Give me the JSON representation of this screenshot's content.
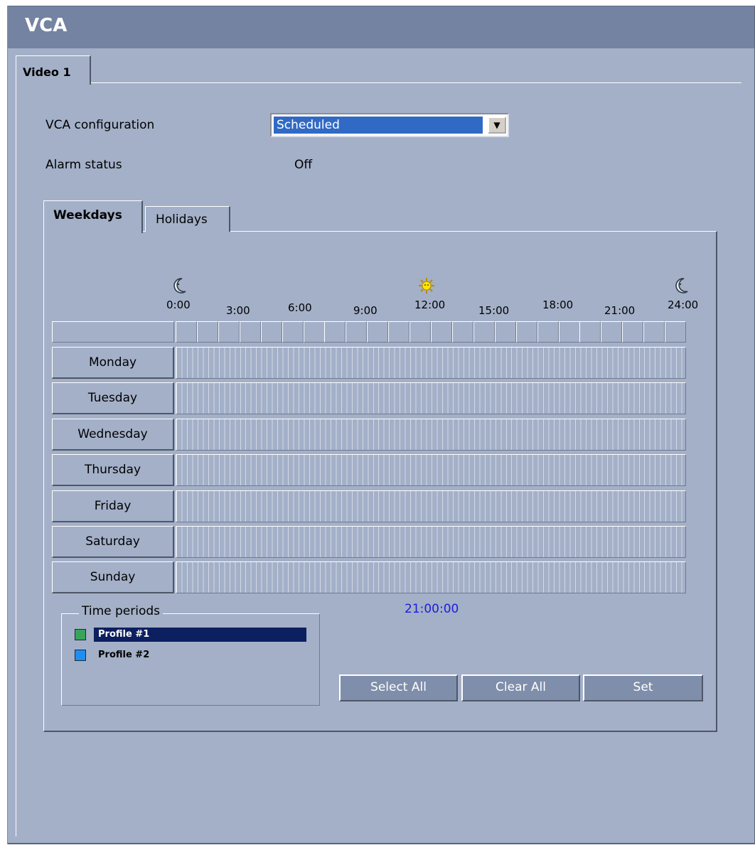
{
  "header": {
    "title": "VCA"
  },
  "tabs": {
    "video": "Video 1"
  },
  "config": {
    "vca_label": "VCA configuration",
    "vca_value": "Scheduled",
    "alarm_label": "Alarm status",
    "alarm_value": "Off"
  },
  "schedule_tabs": {
    "weekdays": "Weekdays",
    "holidays": "Holidays"
  },
  "timeline": {
    "hour_labels": [
      "0:00",
      "3:00",
      "6:00",
      "9:00",
      "12:00",
      "15:00",
      "18:00",
      "21:00",
      "24:00"
    ],
    "icons": [
      "moon-icon",
      "sun-icon",
      "moon-icon"
    ]
  },
  "days": [
    "Monday",
    "Tuesday",
    "Wednesday",
    "Thursday",
    "Friday",
    "Saturday",
    "Sunday"
  ],
  "cursor_time": "21:00:00",
  "time_periods": {
    "title": "Time periods",
    "profiles": [
      {
        "label": "Profile #1",
        "color": "#3aa35a",
        "selected": true
      },
      {
        "label": "Profile #2",
        "color": "#1f8fef",
        "selected": false
      }
    ]
  },
  "buttons": {
    "select_all": "Select All",
    "clear_all": "Clear All",
    "set": "Set"
  },
  "colors": {
    "panel_bg": "#a3b0c8",
    "title_bar": "#7483a2",
    "selection": "#0c1f5f",
    "time_text": "#1c1cdc"
  }
}
